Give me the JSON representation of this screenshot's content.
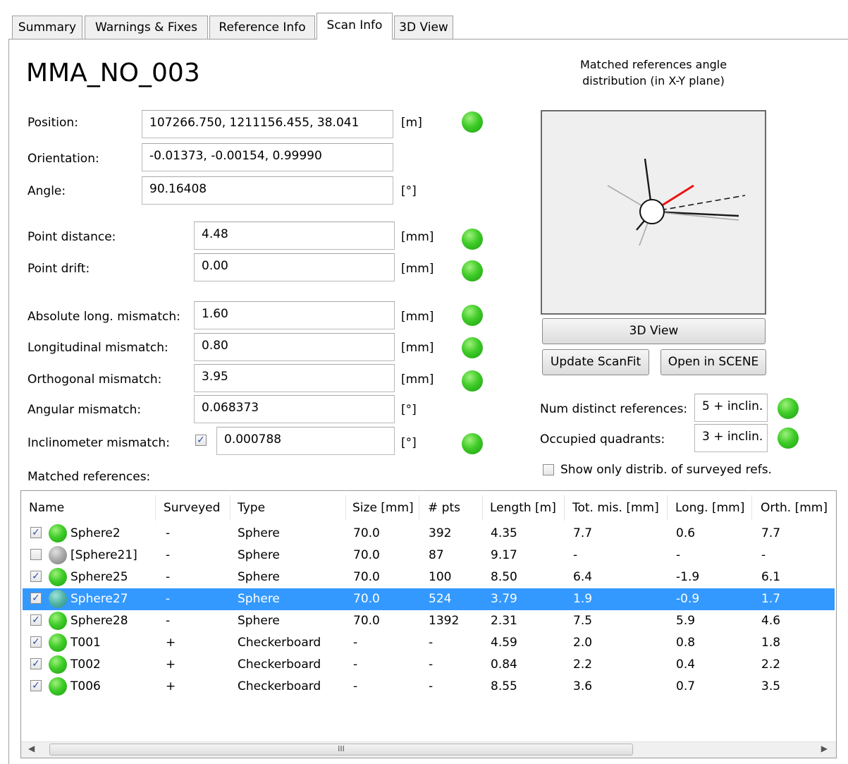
{
  "tabs": [
    {
      "label": "Summary",
      "active": false
    },
    {
      "label": "Warnings & Fixes",
      "active": false
    },
    {
      "label": "Reference Info",
      "active": false
    },
    {
      "label": "Scan Info",
      "active": true
    },
    {
      "label": "3D View",
      "active": false
    }
  ],
  "scan_name": "MMA_NO_003",
  "fields": {
    "position": {
      "label": "Position:",
      "value": "107266.750, 1211156.455, 38.041",
      "unit": "[m]",
      "status": "ok"
    },
    "orientation": {
      "label": "Orientation:",
      "value": "-0.01373, -0.00154, 0.99990"
    },
    "angle": {
      "label": "Angle:",
      "value": "90.16408",
      "unit": "[°]"
    },
    "point_distance": {
      "label": "Point distance:",
      "value": "4.48",
      "unit": "[mm]",
      "status": "ok"
    },
    "point_drift": {
      "label": "Point drift:",
      "value": "0.00",
      "unit": "[mm]",
      "status": "ok"
    },
    "abs_long_mismatch": {
      "label": "Absolute long. mismatch:",
      "value": "1.60",
      "unit": "[mm]",
      "status": "ok"
    },
    "long_mismatch": {
      "label": "Longitudinal mismatch:",
      "value": "0.80",
      "unit": "[mm]",
      "status": "ok"
    },
    "orth_mismatch": {
      "label": "Orthogonal mismatch:",
      "value": "3.95",
      "unit": "[mm]",
      "status": "ok"
    },
    "angular_mismatch": {
      "label": "Angular mismatch:",
      "value": "0.068373",
      "unit": "[°]"
    },
    "inclinometer_mismatch": {
      "label": "Inclinometer mismatch:",
      "value": "0.000788",
      "unit": "[°]",
      "checked": true,
      "status": "ok"
    }
  },
  "distribution": {
    "title_line1": "Matched references angle",
    "title_line2": "distribution (in X-Y plane)"
  },
  "buttons": {
    "view3d": "3D View",
    "update_scanfit": "Update ScanFit",
    "open_scene": "Open in SCENE"
  },
  "references_summary": {
    "num_distinct_label": "Num distinct references:",
    "num_distinct_value": "5 + inclin.",
    "quadrants_label": "Occupied quadrants:",
    "quadrants_value": "3 + inclin.",
    "show_only_label": "Show only distrib. of surveyed refs.",
    "show_only_checked": false
  },
  "matched_label": "Matched references:",
  "table": {
    "columns": [
      "Name",
      "Surveyed",
      "Type",
      "Size [mm]",
      "# pts",
      "Length [m]",
      "Tot. mis. [mm]",
      "Long. [mm]",
      "Orth. [mm]"
    ],
    "rows": [
      {
        "checked": true,
        "status": "green",
        "name": "Sphere2",
        "surveyed": "-",
        "type": "Sphere",
        "size": "70.0",
        "pts": "392",
        "length": "4.35",
        "tot": "7.7",
        "long": "0.6",
        "orth": "7.7",
        "selected": false
      },
      {
        "checked": false,
        "status": "gray",
        "name": "[Sphere21]",
        "surveyed": "-",
        "type": "Sphere",
        "size": "70.0",
        "pts": "87",
        "length": "9.17",
        "tot": "-",
        "long": "-",
        "orth": "-",
        "selected": false
      },
      {
        "checked": true,
        "status": "green",
        "name": "Sphere25",
        "surveyed": "-",
        "type": "Sphere",
        "size": "70.0",
        "pts": "100",
        "length": "8.50",
        "tot": "6.4",
        "long": "-1.9",
        "orth": "6.1",
        "selected": false
      },
      {
        "checked": true,
        "status": "teal",
        "name": "Sphere27",
        "surveyed": "-",
        "type": "Sphere",
        "size": "70.0",
        "pts": "524",
        "length": "3.79",
        "tot": "1.9",
        "long": "-0.9",
        "orth": "1.7",
        "selected": true
      },
      {
        "checked": true,
        "status": "green",
        "name": "Sphere28",
        "surveyed": "-",
        "type": "Sphere",
        "size": "70.0",
        "pts": "1392",
        "length": "2.31",
        "tot": "7.5",
        "long": "5.9",
        "orth": "4.6",
        "selected": false
      },
      {
        "checked": true,
        "status": "green",
        "name": "T001",
        "surveyed": "+",
        "type": "Checkerboard",
        "size": "-",
        "pts": "-",
        "length": "4.59",
        "tot": "2.0",
        "long": "0.8",
        "orth": "1.8",
        "selected": false
      },
      {
        "checked": true,
        "status": "green",
        "name": "T002",
        "surveyed": "+",
        "type": "Checkerboard",
        "size": "-",
        "pts": "-",
        "length": "0.84",
        "tot": "2.2",
        "long": "0.4",
        "orth": "2.2",
        "selected": false
      },
      {
        "checked": true,
        "status": "green",
        "name": "T006",
        "surveyed": "+",
        "type": "Checkerboard",
        "size": "-",
        "pts": "-",
        "length": "8.55",
        "tot": "3.6",
        "long": "0.7",
        "orth": "3.5",
        "selected": false
      }
    ]
  },
  "scrollbar_grip": "III"
}
